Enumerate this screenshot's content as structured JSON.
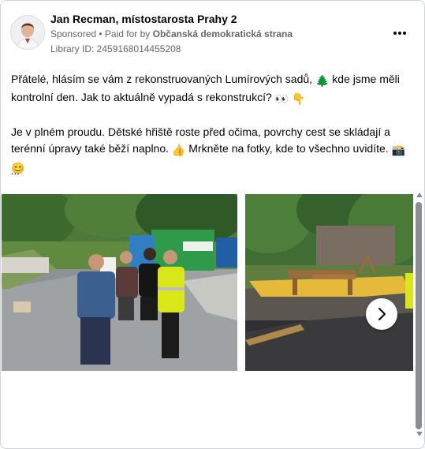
{
  "post": {
    "page_name": "Jan Recman, místostarosta Prahy 2",
    "sponsored_label": "Sponsored",
    "separator": " • ",
    "paid_for_prefix": "Paid for by ",
    "payer": "Občanská demokratická strana",
    "library_id": "Library ID: 2459168014455208",
    "more_icon": "more-horizontal-icon",
    "text": {
      "p1_part1": "Přátelé, hlásím se vám z rekonstruovaných Lumírových sadů, ",
      "p1_emoji1": "🌲",
      "p1_part2": " kde jsme měli kontrolní den. Jak to aktuálně vypadá s rekonstrukcí? ",
      "p1_emoji2": "👀",
      "p1_emoji3": "👇",
      "p2_part1": "Je v plném proudu. Dětské hřiště roste před očima, povrchy cest se skládají a terénní úpravy také běží naplno. ",
      "p2_emoji1": "👍",
      "p2_part2": " Mrkněte na fotky, kde to všechno uvidíte. ",
      "p2_emoji2": "📸",
      "p2_emoji3": "😊"
    },
    "ellipsis": "...",
    "next_icon": "chevron-right-icon"
  },
  "colors": {
    "text_primary": "#050505",
    "text_secondary": "#65676b",
    "border": "#d0d3d8",
    "scrollbar": "#8a8d91"
  }
}
